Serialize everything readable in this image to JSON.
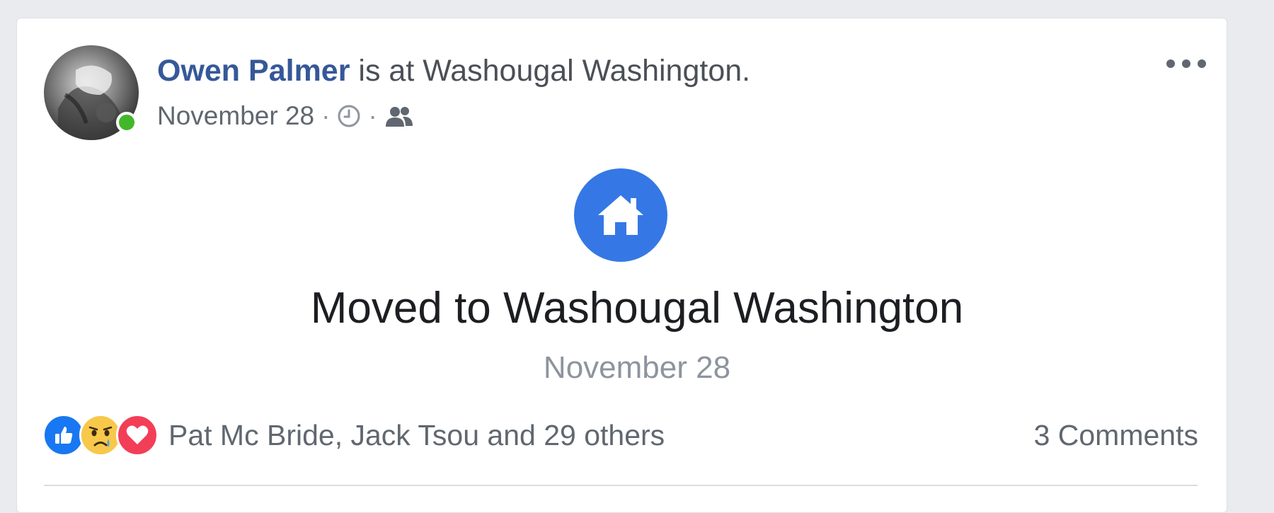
{
  "post": {
    "author": "Owen Palmer",
    "action_text": " is at Washougal Washington.",
    "date": "November 28",
    "separator": "·",
    "privacy_icon": "friends-icon",
    "time_icon": "clock-icon",
    "more_icon": "more-options-icon"
  },
  "life_event": {
    "icon": "home-icon",
    "title": "Moved to Washougal Washington",
    "date": "November 28"
  },
  "reactions": {
    "types": [
      "like",
      "sad",
      "love"
    ],
    "summary": "Pat Mc Bride, Jack Tsou and 29 others"
  },
  "comments": {
    "label": "3 Comments"
  },
  "colors": {
    "author_link": "#365899",
    "online": "#42b72a",
    "life_event_icon_bg": "#3578e5",
    "like": "#1877f2",
    "love": "#f33e58",
    "sad": "#f7c84a"
  }
}
